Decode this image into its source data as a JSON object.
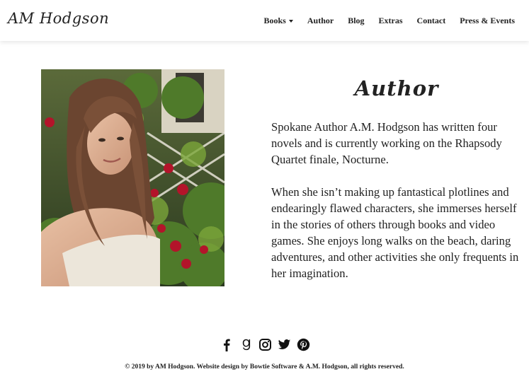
{
  "header": {
    "brand": "AM Hodgson",
    "nav": [
      {
        "label": "Books",
        "has_dropdown": true
      },
      {
        "label": "Author"
      },
      {
        "label": "Blog"
      },
      {
        "label": "Extras"
      },
      {
        "label": "Contact"
      },
      {
        "label": "Press & Events"
      }
    ]
  },
  "main": {
    "title": "Author",
    "paragraphs": [
      "Spokane Author A.M. Hodgson has written four novels and is currently working on the Rhapsody Quartet finale, Nocturne.",
      "When she isn’t making up fantastical plotlines and endearingly flawed characters, she immerses herself in the stories of others through books and video games. She enjoys long walks on the beach, daring adventures, and other activities she only frequents in her imagination."
    ]
  },
  "footer": {
    "social_icons": [
      "facebook-icon",
      "goodreads-icon",
      "instagram-icon",
      "twitter-icon",
      "pinterest-icon"
    ],
    "copyright": "© 2019 by AM Hodgson. Website design by Bowtie Software & A.M. Hodgson, all rights reserved."
  }
}
